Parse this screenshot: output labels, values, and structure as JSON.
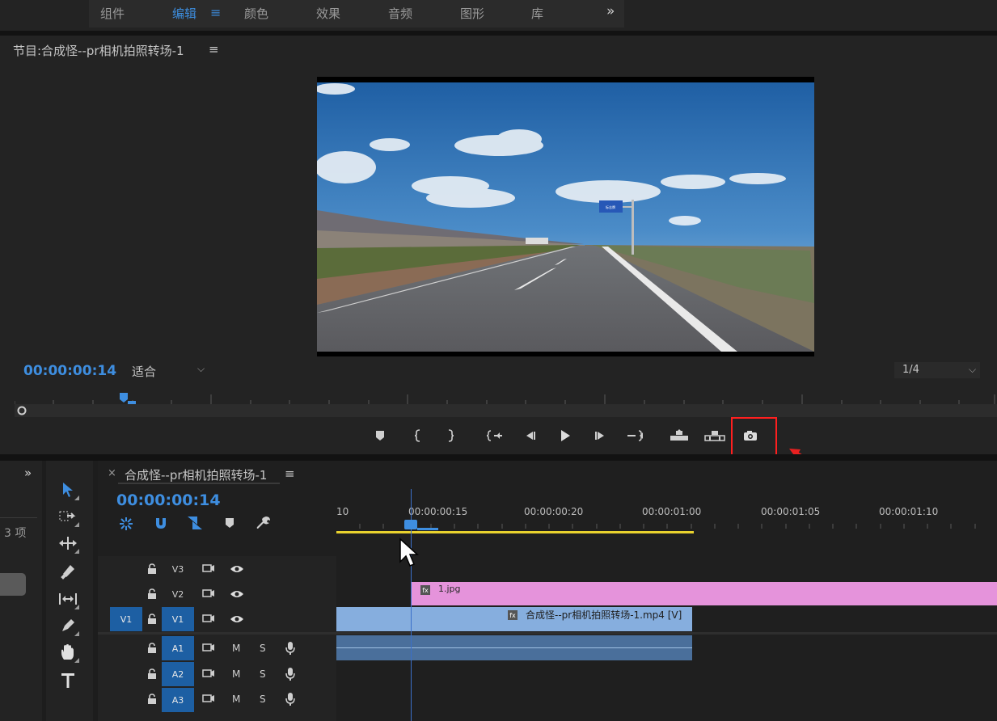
{
  "workspaces": {
    "tabs": [
      {
        "label": "组件",
        "active": false
      },
      {
        "label": "编辑",
        "active": true
      },
      {
        "label": "颜色",
        "active": false
      },
      {
        "label": "效果",
        "active": false
      },
      {
        "label": "音频",
        "active": false
      },
      {
        "label": "图形",
        "active": false
      },
      {
        "label": "库",
        "active": false
      }
    ],
    "menu_glyph": "≡",
    "more_glyph": "»"
  },
  "program_monitor": {
    "title": "节目:合成怪--pr相机拍照转场-1",
    "menu_glyph": "≡",
    "timecode": "00:00:00:14",
    "fit_label": "适合",
    "resolution": "1/4",
    "sign_text": "标志牌",
    "controls": [
      {
        "name": "add-marker-button",
        "icon": "marker-icon"
      },
      {
        "name": "mark-in-button",
        "icon": "mark-in-icon"
      },
      {
        "name": "mark-out-button",
        "icon": "mark-out-icon"
      },
      {
        "name": "go-to-in-button",
        "icon": "go-to-in-icon"
      },
      {
        "name": "step-back-button",
        "icon": "step-back-icon"
      },
      {
        "name": "play-button",
        "icon": "play-icon"
      },
      {
        "name": "step-forward-button",
        "icon": "step-forward-icon"
      },
      {
        "name": "go-to-out-button",
        "icon": "go-to-out-icon"
      },
      {
        "name": "lift-button",
        "icon": "lift-icon"
      },
      {
        "name": "extract-button",
        "icon": "extract-icon"
      },
      {
        "name": "export-frame-button",
        "icon": "camera-icon"
      }
    ]
  },
  "left_panel": {
    "more_glyph": "»",
    "item_count": "3 项"
  },
  "timeline": {
    "sequence_title": "合成怪--pr相机拍照转场-1",
    "close_glyph": "×",
    "menu_glyph": "≡",
    "timecode": "00:00:00:14",
    "ticks": [
      "10",
      "00:00:00:15",
      "00:00:00:20",
      "00:00:01:00",
      "00:00:01:05",
      "00:00:01:10"
    ],
    "video_tracks": [
      {
        "name": "V3",
        "target": "",
        "selected": false
      },
      {
        "name": "V2",
        "target": "",
        "selected": false
      },
      {
        "name": "V1",
        "target": "V1",
        "selected": true
      }
    ],
    "audio_tracks": [
      {
        "name": "A1",
        "m": "M",
        "s": "S"
      },
      {
        "name": "A2",
        "m": "M",
        "s": "S"
      },
      {
        "name": "A3",
        "m": "M",
        "s": "S"
      }
    ],
    "clips": {
      "jpg_label": "1.jpg",
      "mp4_label": "合成怪--pr相机拍照转场-1.mp4 [V]",
      "fx_glyph": "fx"
    }
  }
}
